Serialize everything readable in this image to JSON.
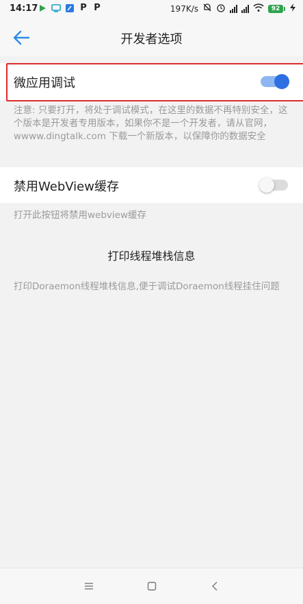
{
  "status_bar": {
    "time": "14:17",
    "speed": "197K/s",
    "battery": "92",
    "app_icons": [
      "play-icon",
      "monitor-icon",
      "notes-icon",
      "p-app-icon",
      "p-app-icon"
    ],
    "app_p_letter": "P"
  },
  "header": {
    "title": "开发者选项",
    "back_icon": "arrow-left-icon"
  },
  "settings": {
    "micro_app_debug": {
      "label": "微应用调试",
      "enabled": true,
      "note": "注意: 只要打开，将处于调试模式，在这里的数据不再特别安全，这个版本是开发者专用版本，如果你不是一个开发者，请从官网，wwww.dingtalk.com 下载一个新版本，以保障你的数据安全"
    },
    "disable_webview_cache": {
      "label": "禁用WebView缓存",
      "enabled": false,
      "note": "打开此按钮将禁用webview缓存"
    },
    "print_thread_stack": {
      "label": "打印线程堆栈信息",
      "note": "打印Doraemon线程堆栈信息,便于调试Doraemon线程挂住问题"
    }
  },
  "colors": {
    "accent": "#2e6fe3",
    "highlight_border": "#e02a2a",
    "battery": "#2ea34e"
  },
  "nav_bar": {
    "items": [
      "menu-icon",
      "home-square-icon",
      "back-chevron-icon"
    ]
  }
}
